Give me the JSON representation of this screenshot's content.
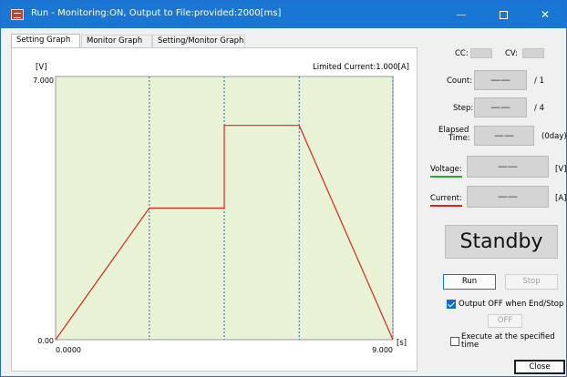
{
  "window": {
    "title": "Run - Monitoring:ON, Output to File:provided:2000[ms]",
    "minimize_icon": "minimize-icon",
    "maximize_icon": "maximize-icon",
    "close_icon": "close-icon",
    "close_glyph": "✕"
  },
  "tabs": [
    {
      "label": "Setting Graph",
      "active": true
    },
    {
      "label": "Monitor Graph",
      "active": false
    },
    {
      "label": "Setting/Monitor Graph",
      "active": false
    }
  ],
  "graph": {
    "y_unit": "[V]",
    "x_unit": "[s]",
    "limited_current": "Limited Current:1.000[A]",
    "y_max_label": "7.000",
    "y_min_label": "0.00",
    "x_min_label": "0.0000",
    "x_max_label": "9.000",
    "plot_color": "#e8f3d6",
    "line_color": "#e0231e",
    "divider_color": "#2f5fc4"
  },
  "chart_data": {
    "type": "line",
    "title": "",
    "xlabel": "[s]",
    "ylabel": "[V]",
    "xlim": [
      0,
      9
    ],
    "ylim": [
      0,
      7
    ],
    "series": [
      {
        "x": [
          0,
          2.5,
          2.5,
          4.5,
          4.5,
          6.5,
          6.5,
          9
        ],
        "y": [
          0,
          3.5,
          3.5,
          3.5,
          5.7,
          5.7,
          5.7,
          0
        ]
      }
    ],
    "step_boundaries": [
      2.5,
      4.5,
      6.5,
      9
    ]
  },
  "side": {
    "cc_label": "CC:",
    "cv_label": "CV:",
    "count_label": "Count:",
    "count_value": "——",
    "count_total": "/ 1",
    "step_label": "Step:",
    "step_value": "——",
    "step_total": "/ 4",
    "elapsed_label_1": "Elapsed",
    "elapsed_label_2": "Time:",
    "elapsed_value": "——",
    "elapsed_days": "(0day)",
    "voltage_label": "Voltage:",
    "voltage_value": "——",
    "voltage_unit": "[V]",
    "voltage_color": "#2fa52f",
    "current_label": "Current:",
    "current_value": "——",
    "current_unit": "[A]",
    "current_color": "#e0231e",
    "status": "Standby",
    "run_label": "Run",
    "stop_label": "Stop",
    "output_off_label": "Output OFF when End/Stop",
    "output_off_checked": true,
    "off_button_label": "OFF",
    "execute_label_1": "Execute at the specified",
    "execute_label_2": "time",
    "execute_checked": false,
    "close_label": "Close"
  }
}
